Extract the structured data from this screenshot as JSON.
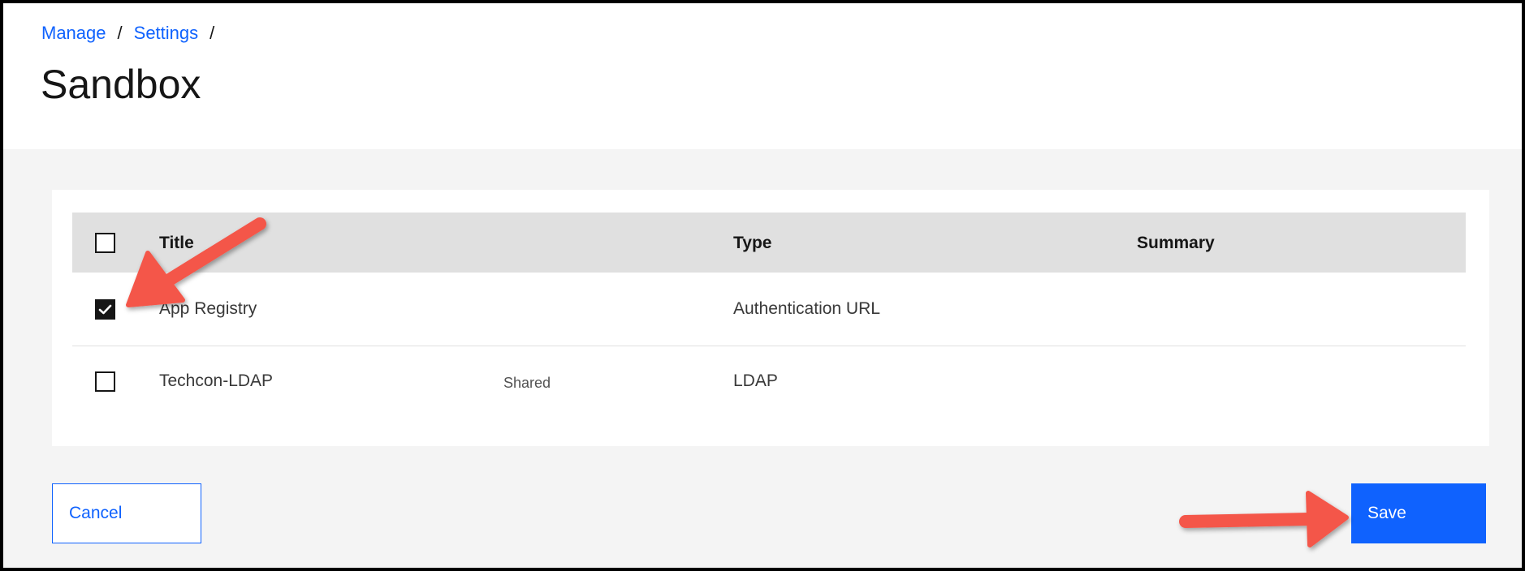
{
  "breadcrumb": {
    "items": [
      "Manage",
      "Settings"
    ],
    "separator": "/"
  },
  "page": {
    "title": "Sandbox"
  },
  "table": {
    "columns": {
      "title": "Title",
      "type": "Type",
      "summary": "Summary"
    },
    "rows": [
      {
        "title": "App Registry",
        "tag": "",
        "type": "Authentication URL",
        "summary": "",
        "checked": true
      },
      {
        "title": "Techcon-LDAP",
        "tag": "Shared",
        "type": "LDAP",
        "summary": "",
        "checked": false
      }
    ]
  },
  "actions": {
    "cancel_label": "Cancel",
    "save_label": "Save"
  },
  "colors": {
    "primary": "#0f62fe",
    "header_bg": "#e0e0e0",
    "page_bg": "#f4f4f4",
    "annotation_arrow": "#f4574a"
  },
  "icons": {
    "checkmark": "checkmark-icon",
    "annotation": "arrow-annotation-icon"
  }
}
